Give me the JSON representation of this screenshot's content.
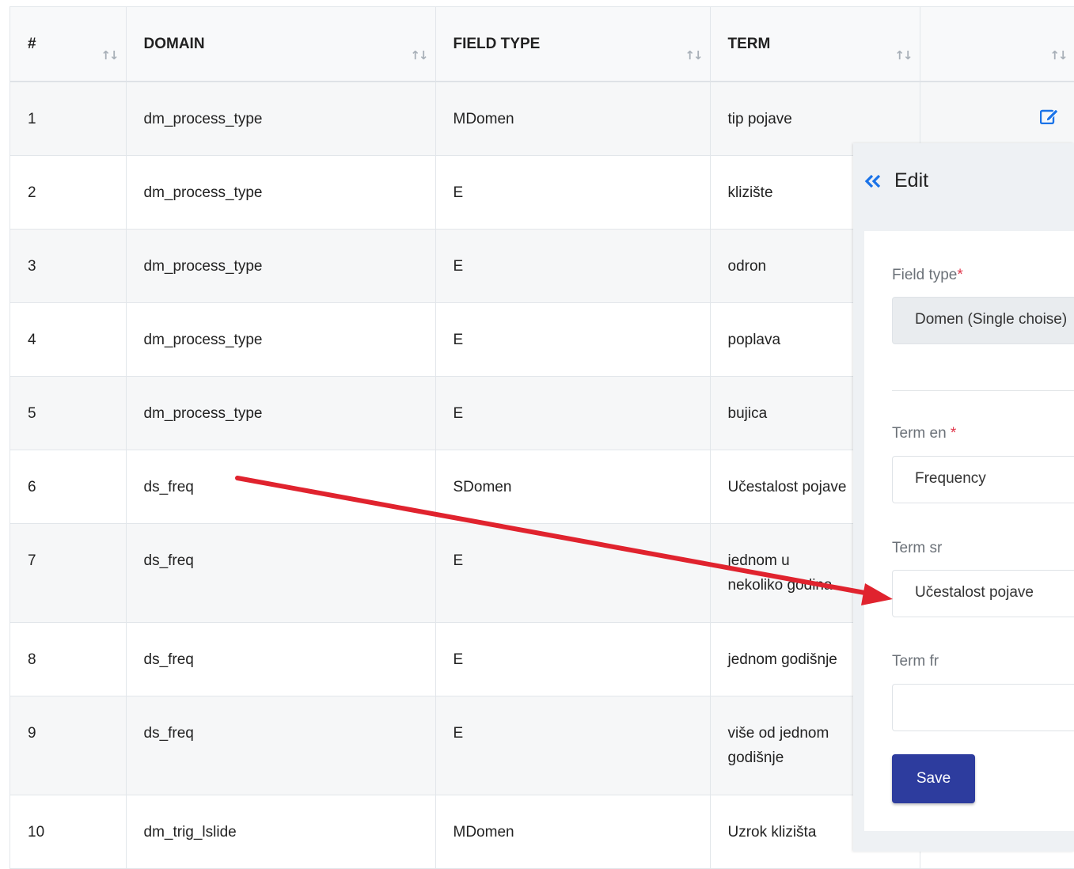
{
  "table": {
    "headers": [
      "#",
      "DOMAIN",
      "FIELD TYPE",
      "TERM",
      ""
    ],
    "rows": [
      {
        "num": "1",
        "domain": "dm_process_type",
        "field_type": "MDomen",
        "term": "tip pojave"
      },
      {
        "num": "2",
        "domain": "dm_process_type",
        "field_type": "E",
        "term": "klizište"
      },
      {
        "num": "3",
        "domain": "dm_process_type",
        "field_type": "E",
        "term": "odron"
      },
      {
        "num": "4",
        "domain": "dm_process_type",
        "field_type": "E",
        "term": "poplava"
      },
      {
        "num": "5",
        "domain": "dm_process_type",
        "field_type": "E",
        "term": "bujica"
      },
      {
        "num": "6",
        "domain": "ds_freq",
        "field_type": "SDomen",
        "term": "Učestalost pojave"
      },
      {
        "num": "7",
        "domain": "ds_freq",
        "field_type": "E",
        "term": "jednom u nekoliko godina"
      },
      {
        "num": "8",
        "domain": "ds_freq",
        "field_type": "E",
        "term": "jednom godišnje"
      },
      {
        "num": "9",
        "domain": "ds_freq",
        "field_type": "E",
        "term": "više od jednom godišnje"
      },
      {
        "num": "10",
        "domain": "dm_trig_lslide",
        "field_type": "MDomen",
        "term": "Uzrok klizišta"
      }
    ]
  },
  "edit_panel": {
    "title": "Edit",
    "field_type_label": "Field type",
    "field_type_value": "Domen (Single choise)",
    "term_en_label": "Term en",
    "term_en_value": "Frequency",
    "term_sr_label": "Term sr",
    "term_sr_value": "Učestalost pojave",
    "term_fr_label": "Term fr",
    "term_fr_value": "",
    "required_mark": "*",
    "save_label": "Save"
  },
  "colors": {
    "accent": "#2d3c9e",
    "edit_icon": "#1a73e8",
    "required": "#e0354a",
    "annotation_arrow": "#e0232e"
  },
  "icons": {
    "sort": "sort-arrows-icon",
    "edit": "edit-icon",
    "back": "double-chevron-left-icon"
  }
}
